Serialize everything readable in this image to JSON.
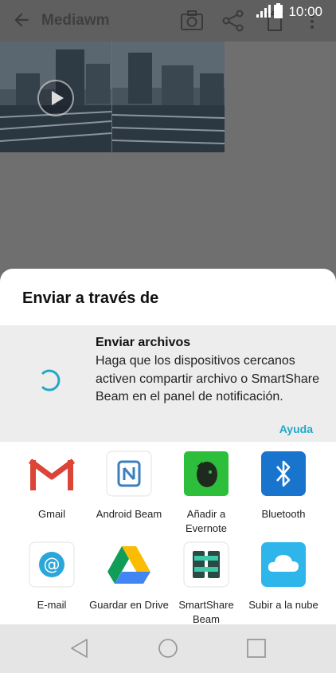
{
  "app_bar": {
    "title": "Mediawm",
    "icons": [
      "back-arrow-icon",
      "camera-icon",
      "share-icon",
      "trash-icon",
      "more-vert-icon"
    ]
  },
  "status_bar": {
    "time": "10:00",
    "icons": [
      "signal-icon",
      "battery-icon"
    ]
  },
  "gallery": {
    "items": [
      {
        "type": "video",
        "icon": "play-icon"
      },
      {
        "type": "image"
      }
    ]
  },
  "share_sheet": {
    "title": "Enviar a través de",
    "beam_panel": {
      "heading": "Enviar archivos",
      "body": "Haga que los dispositivos cercanos activen compartir archivo o SmartShare Beam en el panel de notificación.",
      "help_link": "Ayuda"
    },
    "apps": [
      {
        "label": "Gmail",
        "icon": "gmail-icon"
      },
      {
        "label": "Android Beam",
        "icon": "nfc-icon"
      },
      {
        "label": "Añadir a Evernote",
        "icon": "evernote-icon"
      },
      {
        "label": "Bluetooth",
        "icon": "bluetooth-icon"
      },
      {
        "label": "E-mail",
        "icon": "email-icon"
      },
      {
        "label": "Guardar en Drive",
        "icon": "google-drive-icon"
      },
      {
        "label": "SmartShare Beam",
        "icon": "smartshare-beam-icon"
      },
      {
        "label": "Subir a la nube",
        "icon": "cloud-icon"
      }
    ],
    "accent_color": "#23a8c6"
  },
  "nav_bar": {
    "icons": [
      "nav-back-icon",
      "nav-home-icon",
      "nav-recents-icon"
    ]
  }
}
